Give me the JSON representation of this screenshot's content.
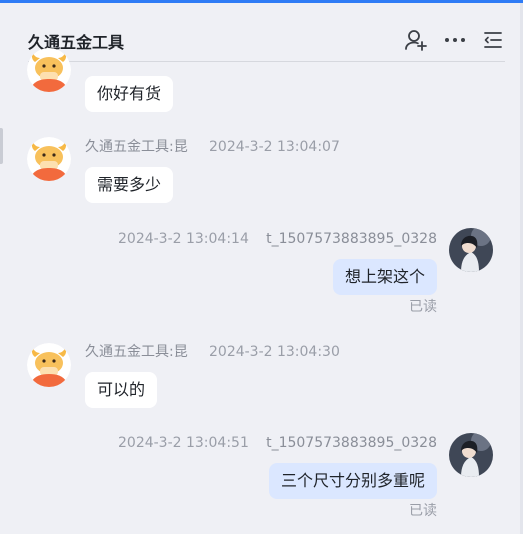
{
  "header": {
    "title": "久通五金工具",
    "icons": [
      "add-user-icon",
      "more-icon",
      "menu-icon"
    ]
  },
  "messages": [
    {
      "direction": "in",
      "text": "你好有货"
    },
    {
      "direction": "in",
      "sender": "久通五金工具:昆",
      "time": "2024-3-2 13:04:07",
      "text": "需要多少"
    },
    {
      "direction": "out",
      "sender": "t_1507573883895_0328",
      "time": "2024-3-2 13:04:14",
      "text": "想上架这个",
      "status": "已读"
    },
    {
      "direction": "in",
      "sender": "久通五金工具:昆",
      "time": "2024-3-2 13:04:30",
      "text": "可以的"
    },
    {
      "direction": "out",
      "sender": "t_1507573883895_0328",
      "time": "2024-3-2 13:04:51",
      "text": "三个尺寸分别多重呢",
      "status": "已读"
    }
  ],
  "colors": {
    "accent": "#2f7cf6",
    "background": "#eff0f5",
    "incoming_bubble": "#ffffff",
    "outgoing_bubble": "#dbe7ff",
    "mascot_orange": "#f26a3d"
  }
}
